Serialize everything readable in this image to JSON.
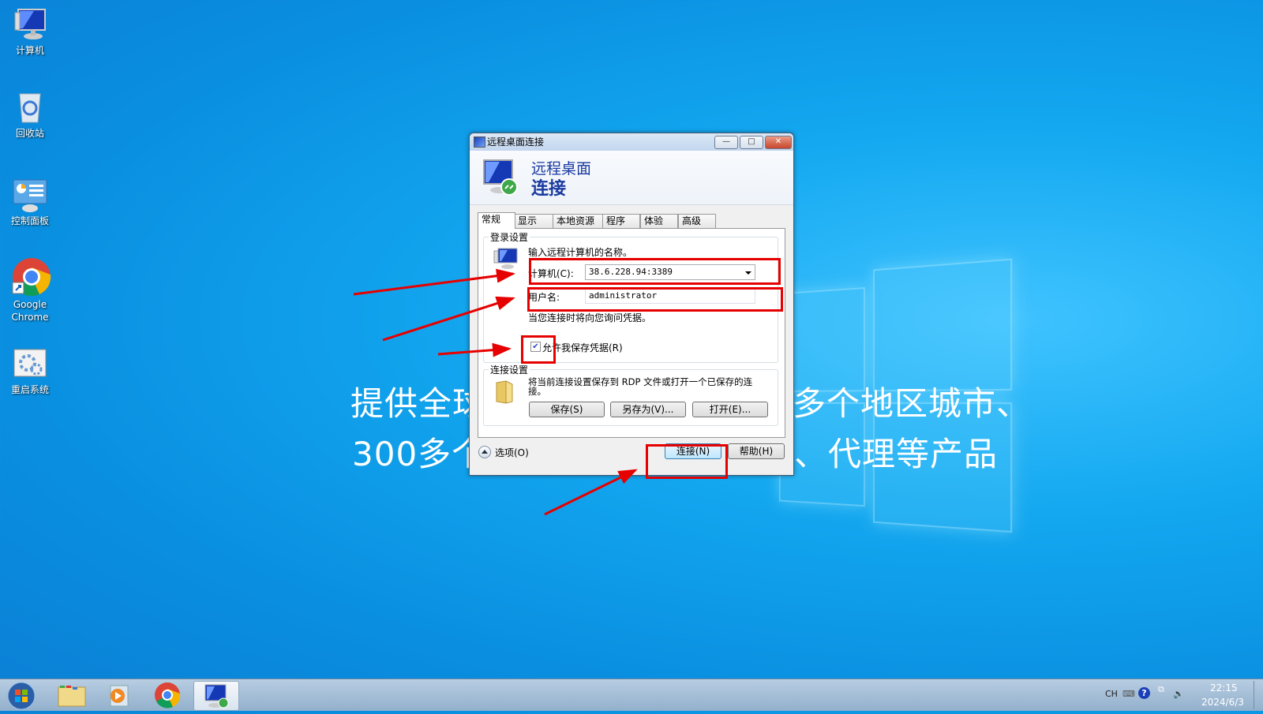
{
  "desktop": {
    "icons": [
      {
        "label": "计算机",
        "icon": "computer-icon"
      },
      {
        "label": "回收站",
        "icon": "recycle-bin-icon"
      },
      {
        "label": "控制面板",
        "icon": "control-panel-icon"
      },
      {
        "label": "Google Chrome",
        "icon": "chrome-icon"
      },
      {
        "label": "重启系统",
        "icon": "restart-system-icon"
      }
    ],
    "overlay_line1_left": "提供全球",
    "overlay_line1_right": "多个地区城市、",
    "overlay_line2_left": "300多个",
    "overlay_line2_right": "、代理等产品"
  },
  "dialog": {
    "title": "远程桌面连接",
    "window_buttons": {
      "minimize": "—",
      "maximize": "□",
      "close": "✕"
    },
    "header_line1": "远程桌面",
    "header_line2": "连接",
    "tabs": [
      "常规",
      "显示",
      "本地资源",
      "程序",
      "体验",
      "高级"
    ],
    "active_tab": "常规",
    "login_group": {
      "label": "登录设置",
      "prompt": "输入远程计算机的名称。",
      "computer_label": "计算机(C):",
      "computer_value": "38.6.228.94:3389",
      "username_label": "用户名:",
      "username_value": "administrator",
      "credential_note": "当您连接时将向您询问凭据。",
      "save_credentials_label": "允许我保存凭据(R)",
      "save_credentials_checked": true
    },
    "connection_group": {
      "label": "连接设置",
      "description": "将当前连接设置保存到 RDP 文件或打开一个已保存的连接。",
      "save_button": "保存(S)",
      "save_as_button": "另存为(V)...",
      "open_button": "打开(E)..."
    },
    "options_label": "选项(O)",
    "connect_button": "连接(N)",
    "help_button": "帮助(H)"
  },
  "annotation_color": "#e60000",
  "taskbar": {
    "items": [
      "start-button",
      "file-explorer",
      "media-player",
      "chrome",
      "remote-desktop"
    ],
    "language": "CH",
    "time": "22:15",
    "date": "2024/6/3"
  }
}
